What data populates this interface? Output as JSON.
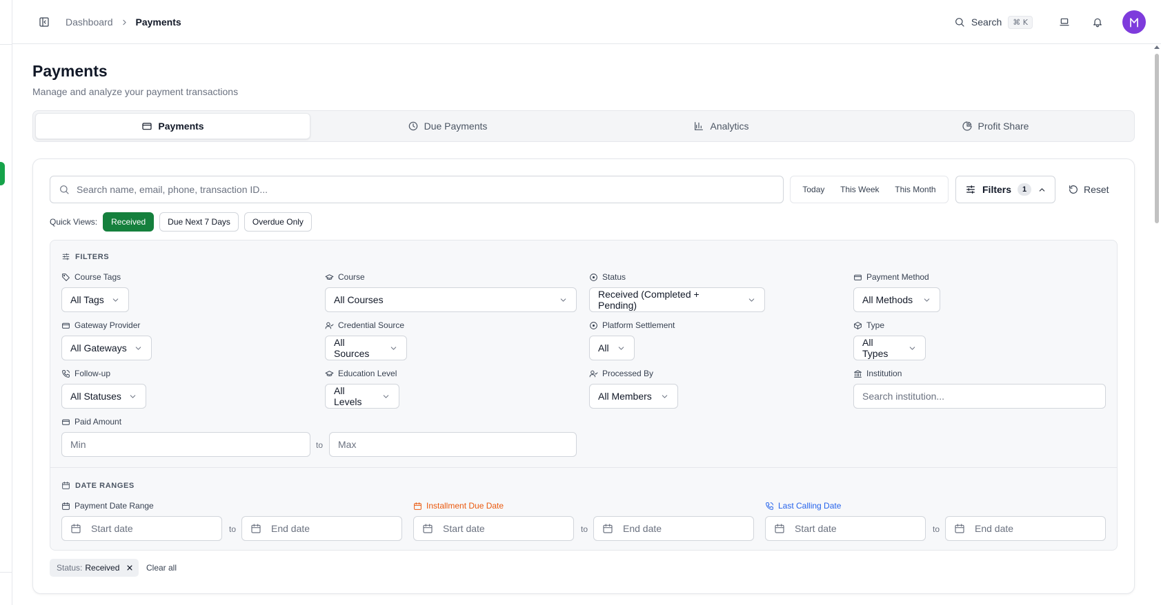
{
  "header": {
    "breadcrumb": {
      "parent": "Dashboard",
      "current": "Payments"
    },
    "search": {
      "label": "Search",
      "shortcut": "⌘ K"
    },
    "avatar_initial": "M",
    "avatar_color": "#7e3bdc"
  },
  "page": {
    "title": "Payments",
    "subtitle": "Manage and analyze your payment transactions"
  },
  "tabs": [
    {
      "label": "Payments",
      "icon": "credit-card-icon",
      "active": true
    },
    {
      "label": "Due Payments",
      "icon": "clock-icon",
      "active": false
    },
    {
      "label": "Analytics",
      "icon": "bar-chart-icon",
      "active": false
    },
    {
      "label": "Profit Share",
      "icon": "pie-chart-icon",
      "active": false
    }
  ],
  "toolbar": {
    "search_placeholder": "Search name, email, phone, transaction ID...",
    "presets": [
      "Today",
      "This Week",
      "This Month"
    ],
    "filters_label": "Filters",
    "filters_count": "1",
    "reset_label": "Reset"
  },
  "quick_views": {
    "label": "Quick Views:",
    "items": [
      {
        "label": "Received",
        "active": true
      },
      {
        "label": "Due Next 7 Days",
        "active": false
      },
      {
        "label": "Overdue Only",
        "active": false
      }
    ]
  },
  "filters": {
    "title": "FILTERS",
    "course_tags": {
      "label": "Course Tags",
      "value": "All Tags"
    },
    "course": {
      "label": "Course",
      "value": "All Courses"
    },
    "status": {
      "label": "Status",
      "value": "Received (Completed + Pending)"
    },
    "payment_method": {
      "label": "Payment Method",
      "value": "All Methods"
    },
    "gateway_provider": {
      "label": "Gateway Provider",
      "value": "All Gateways"
    },
    "credential_source": {
      "label": "Credential Source",
      "value": "All Sources"
    },
    "platform_settlement": {
      "label": "Platform Settlement",
      "value": "All"
    },
    "type": {
      "label": "Type",
      "value": "All Types"
    },
    "follow_up": {
      "label": "Follow-up",
      "value": "All Statuses"
    },
    "education_level": {
      "label": "Education Level",
      "value": "All Levels"
    },
    "processed_by": {
      "label": "Processed By",
      "value": "All Members"
    },
    "institution": {
      "label": "Institution",
      "placeholder": "Search institution..."
    },
    "paid_amount": {
      "label": "Paid Amount",
      "min_placeholder": "Min",
      "max_placeholder": "Max",
      "to": "to"
    }
  },
  "date_ranges": {
    "title": "DATE RANGES",
    "to": "to",
    "payment_date": {
      "label": "Payment Date Range",
      "start": "Start date",
      "end": "End date"
    },
    "installment_due": {
      "label": "Installment Due Date",
      "start": "Start date",
      "end": "End date",
      "color": "#ea580c"
    },
    "last_calling": {
      "label": "Last Calling Date",
      "start": "Start date",
      "end": "End date",
      "color": "#2563eb"
    }
  },
  "active_filters": {
    "chip_key": "Status:",
    "chip_value": "Received",
    "clear_all": "Clear all"
  },
  "colors": {
    "accent_green": "#15803d",
    "rail_green": "#16a34a"
  }
}
